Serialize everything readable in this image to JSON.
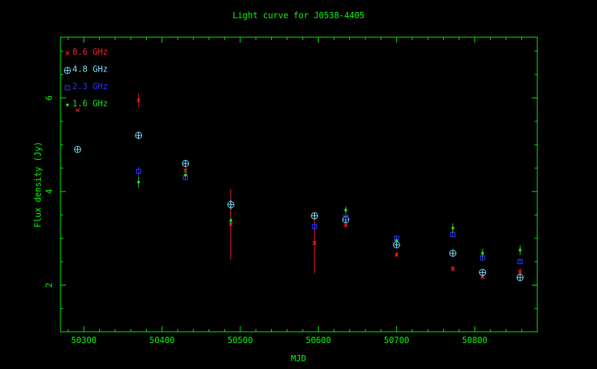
{
  "chart_data": {
    "type": "scatter",
    "title": "Light curve for J0538-4405",
    "xlabel": "MJD",
    "ylabel": "Flux density (Jy)",
    "xlim": [
      50270,
      50880
    ],
    "ylim": [
      1,
      7.3
    ],
    "xticks": [
      50300,
      50400,
      50500,
      50600,
      50700,
      50800
    ],
    "xtick_labels": [
      "50300",
      "50400",
      "50500",
      "50600",
      "50700",
      "50800"
    ],
    "yticks": [
      2,
      4,
      6
    ],
    "ytick_labels": [
      "2",
      "4",
      "6"
    ],
    "grid": false,
    "legend_position": "top-left",
    "colors": {
      "frame": "#00ff00",
      "title": "#00ff00",
      "axis_label": "#00ff00",
      "tick_label": "#00ff00"
    },
    "series": [
      {
        "name": "8.6 GHz",
        "marker": "x",
        "color": "#ff2020",
        "points": [
          {
            "x": 50292,
            "y": 5.74,
            "err": 0
          },
          {
            "x": 50370,
            "y": 5.95,
            "err": 0.15
          },
          {
            "x": 50430,
            "y": 4.45,
            "err": 0.12
          },
          {
            "x": 50488,
            "y": 3.3,
            "err": 0.75
          },
          {
            "x": 50595,
            "y": 2.9,
            "err": 0.65
          },
          {
            "x": 50635,
            "y": 3.28,
            "err": 0.05
          },
          {
            "x": 50700,
            "y": 2.65,
            "err": 0.05
          },
          {
            "x": 50772,
            "y": 2.35,
            "err": 0.05
          },
          {
            "x": 50810,
            "y": 2.18,
            "err": 0.05
          },
          {
            "x": 50858,
            "y": 2.28,
            "err": 0.08
          }
        ]
      },
      {
        "name": "4.8 GHz",
        "marker": "circle-plus",
        "color": "#80e0ff",
        "points": [
          {
            "x": 50292,
            "y": 4.9,
            "err": 0
          },
          {
            "x": 50370,
            "y": 5.2,
            "err": 0.08
          },
          {
            "x": 50430,
            "y": 4.6,
            "err": 0.07
          },
          {
            "x": 50488,
            "y": 3.72,
            "err": 0.1
          },
          {
            "x": 50595,
            "y": 3.48,
            "err": 0.06
          },
          {
            "x": 50635,
            "y": 3.4,
            "err": 0.06
          },
          {
            "x": 50700,
            "y": 2.86,
            "err": 0.05
          },
          {
            "x": 50772,
            "y": 2.68,
            "err": 0.05
          },
          {
            "x": 50810,
            "y": 2.27,
            "err": 0.05
          },
          {
            "x": 50858,
            "y": 2.16,
            "err": 0.05
          }
        ]
      },
      {
        "name": "2.3 GHz",
        "marker": "square",
        "color": "#3030ff",
        "points": [
          {
            "x": 50370,
            "y": 4.43,
            "err": 0.1
          },
          {
            "x": 50430,
            "y": 4.3,
            "err": 0.06
          },
          {
            "x": 50595,
            "y": 3.25,
            "err": 0.06
          },
          {
            "x": 50635,
            "y": 3.45,
            "err": 0.06
          },
          {
            "x": 50700,
            "y": 3.0,
            "err": 0.06
          },
          {
            "x": 50772,
            "y": 3.08,
            "err": 0.06
          },
          {
            "x": 50810,
            "y": 2.58,
            "err": 0.06
          },
          {
            "x": 50858,
            "y": 2.5,
            "err": 0.06
          }
        ]
      },
      {
        "name": "1.6 GHz",
        "marker": "dot",
        "color": "#20e020",
        "points": [
          {
            "x": 50370,
            "y": 4.2,
            "err": 0.12
          },
          {
            "x": 50430,
            "y": 4.35,
            "err": 0.05
          },
          {
            "x": 50488,
            "y": 3.38,
            "err": 0.06
          },
          {
            "x": 50635,
            "y": 3.6,
            "err": 0.08
          },
          {
            "x": 50700,
            "y": 2.95,
            "err": 0.05
          },
          {
            "x": 50772,
            "y": 3.22,
            "err": 0.1
          },
          {
            "x": 50810,
            "y": 2.68,
            "err": 0.1
          },
          {
            "x": 50858,
            "y": 2.75,
            "err": 0.1
          }
        ]
      }
    ]
  }
}
